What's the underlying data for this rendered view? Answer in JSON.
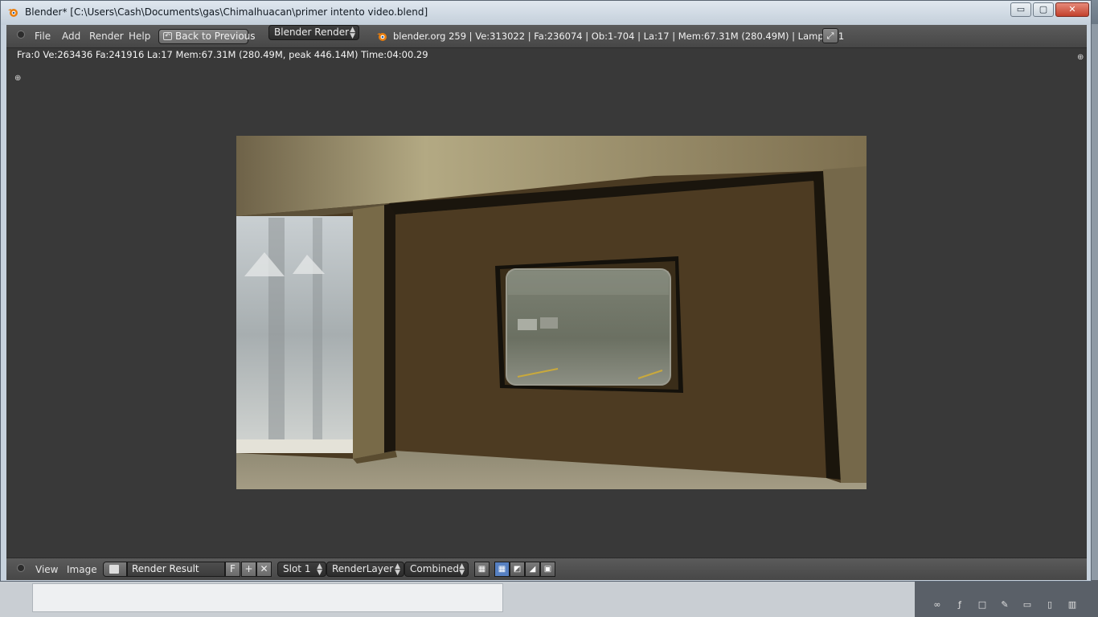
{
  "window": {
    "title": "Blender* [C:\\Users\\Cash\\Documents\\gas\\Chimalhuacan\\primer intento video.blend]",
    "minimize_label": "▭",
    "maximize_label": "▢",
    "close_label": "✕"
  },
  "header": {
    "menus": [
      "File",
      "Add",
      "Render",
      "Help"
    ],
    "back_label": "Back to Previous",
    "engine": "Blender Render",
    "info": "blender.org 259 | Ve:313022 | Fa:236074 | Ob:1-704 | La:17 | Mem:67.31M (280.49M) | Lamp.001"
  },
  "viewport": {
    "stats": "Fra:0  Ve:263436 Fa:241916 La:17 Mem:67.31M (280.49M, peak 446.14M) Time:04:00.29"
  },
  "footer": {
    "menus": [
      "View",
      "Image"
    ],
    "image_name": "Render Result",
    "fake_user_label": "F",
    "new_label": "+",
    "unlink_label": "✕",
    "slot": "Slot 1",
    "layer": "RenderLayer",
    "pass": "Combined"
  },
  "colors": {
    "accent_toggle": "#5680c2",
    "panel_bg": "#393939",
    "header_bg": "#4f4f4f"
  }
}
